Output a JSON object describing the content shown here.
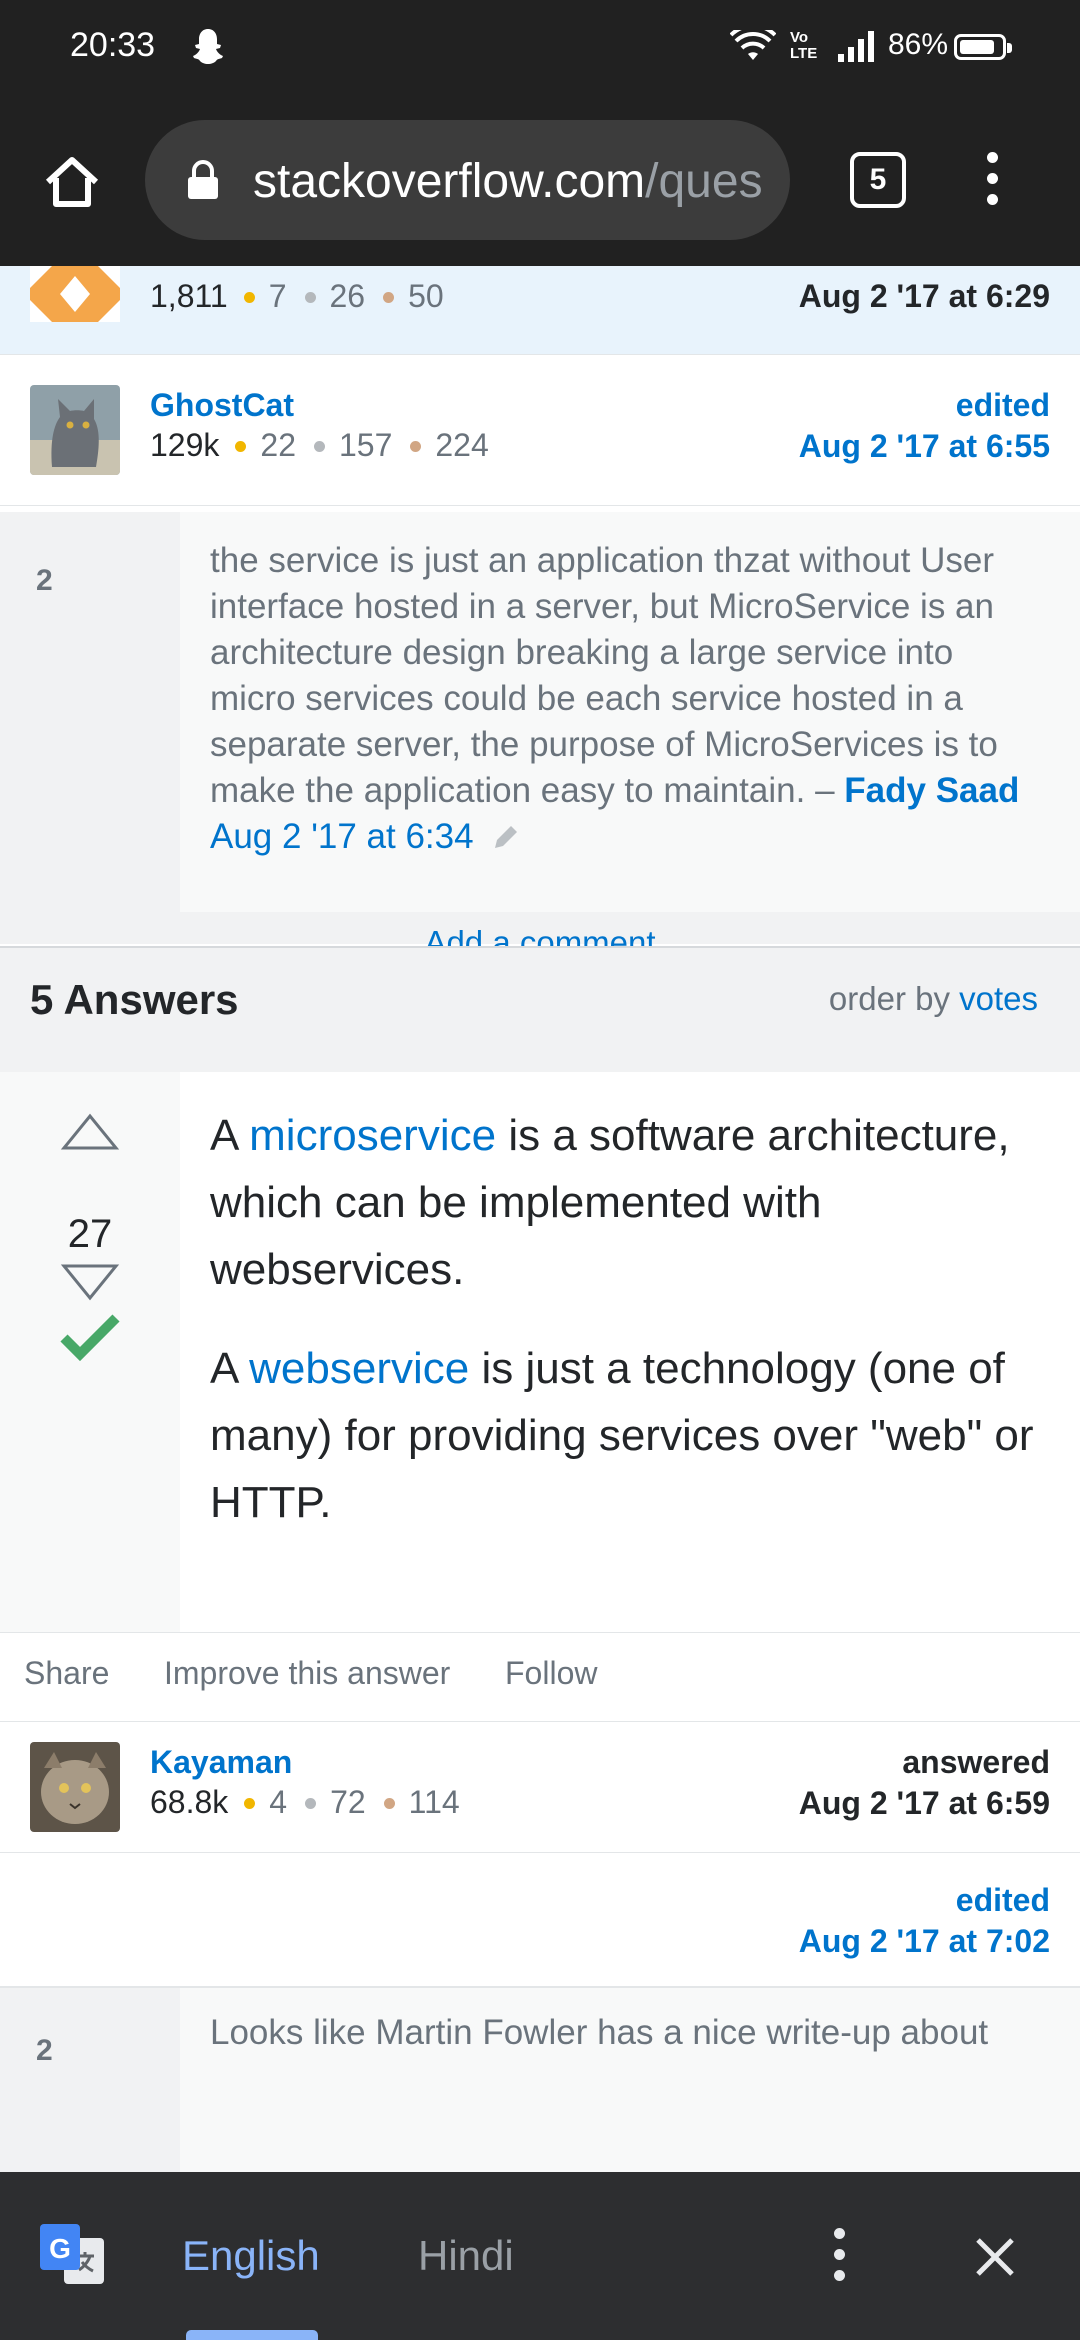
{
  "status_bar": {
    "time": "20:33",
    "volte_label_top": "Vo",
    "volte_label_bottom": "LTE",
    "battery": "86%",
    "battery_level": 0.86
  },
  "browser": {
    "url_host": "stackoverflow.com",
    "url_path": "/ques",
    "tab_count": "5"
  },
  "asker": {
    "reputation": "1,811",
    "gold": "7",
    "silver": "26",
    "bronze": "50",
    "date": "Aug 2 '17 at 6:29"
  },
  "question_editor": {
    "name": "GhostCat",
    "reputation": "129k",
    "gold": "22",
    "silver": "157",
    "bronze": "224",
    "action": "edited",
    "date": "Aug 2 '17 at 6:55"
  },
  "question_comment": {
    "score": "2",
    "text": "the service is just an application thzat without User interface hosted in a server, but MicroService is an architecture design breaking a large service into micro services could be each service hosted in a separate server, the purpose of MicroServices is to make the application easy to maintain.",
    "dash": "–",
    "author": "Fady Saad",
    "date": "Aug 2 '17 at 6:34"
  },
  "add_comment_label": "Add a comment",
  "answers_header": {
    "title": "5 Answers",
    "order_label": "order by",
    "order_value": "votes"
  },
  "answer": {
    "score": "27",
    "accepted": true,
    "p1_a": "A",
    "p1_link": "microservice",
    "p1_b": "is a software architecture, which can be implemented with webservices.",
    "p2_a": "A",
    "p2_link": "webservice",
    "p2_b": "is just a technology (one of many) for providing services over \"web\" or HTTP.",
    "actions": [
      "Share",
      "Improve this answer",
      "Follow"
    ],
    "answerer": {
      "name": "Kayaman",
      "reputation": "68.8k",
      "gold": "4",
      "silver": "72",
      "bronze": "114",
      "action": "answered",
      "date": "Aug 2 '17 at 6:59"
    },
    "editor": {
      "action": "edited",
      "date": "Aug 2 '17 at 7:02"
    }
  },
  "answer_comment": {
    "score": "2",
    "text": "Looks like Martin Fowler has a nice write-up about"
  },
  "translate_bar": {
    "source_lang": "English",
    "target_lang": "Hindi"
  }
}
